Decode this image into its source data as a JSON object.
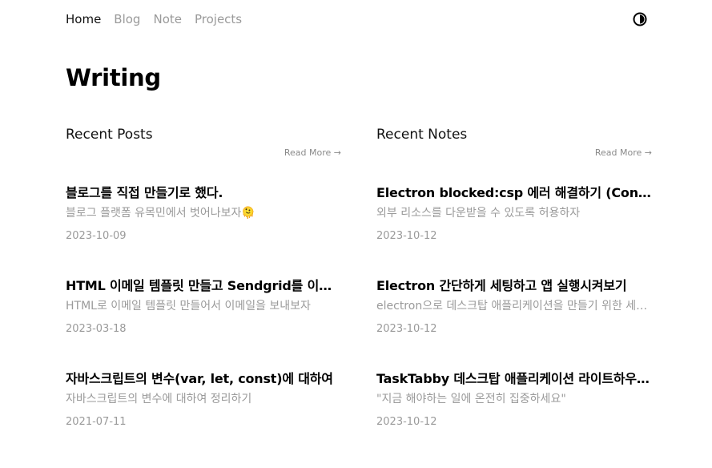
{
  "nav": {
    "home": "Home",
    "blog": "Blog",
    "note": "Note",
    "projects": "Projects",
    "theme_toggle_icon": "half-circle-contrast-icon"
  },
  "page": {
    "title": "Writing"
  },
  "posts": {
    "section_title": "Recent Posts",
    "read_more": "Read More →",
    "items": [
      {
        "title": "블로그를 직접 만들기로 했다.",
        "description": "블로그 플랫폼 유목민에서 벗어나보자🫠",
        "date": "2023-10-09"
      },
      {
        "title": "HTML 이메일 템플릿 만들고 Sendgrid를 이용해서 보내기",
        "description": "HTML로 이메일 템플릿 만들어서 이메일을 보내보자",
        "date": "2023-03-18"
      },
      {
        "title": "자바스크립트의 변수(var, let, const)에 대하여",
        "description": "자바스크립트의 변수에 대하여 정리하기",
        "date": "2021-07-11"
      }
    ]
  },
  "notes": {
    "section_title": "Recent Notes",
    "read_more": "Read More →",
    "items": [
      {
        "title": "Electron blocked:csp 에러 해결하기 (Content Security Policy)",
        "description": "외부 리소스를 다운받을 수 있도록 허용하자",
        "date": "2023-10-12"
      },
      {
        "title": "Electron 간단하게 세팅하고 앱 실행시켜보기",
        "description": "electron으로 데스크탑 애플리케이션을 만들기 위한 세팅하기",
        "date": "2023-10-12"
      },
      {
        "title": "TaskTabby 데스크탑 애플리케이션 라이트하우스 개발기",
        "description": "\"지금 해야하는 일에 온전히 집중하세요\"",
        "date": "2023-10-12"
      }
    ]
  }
}
